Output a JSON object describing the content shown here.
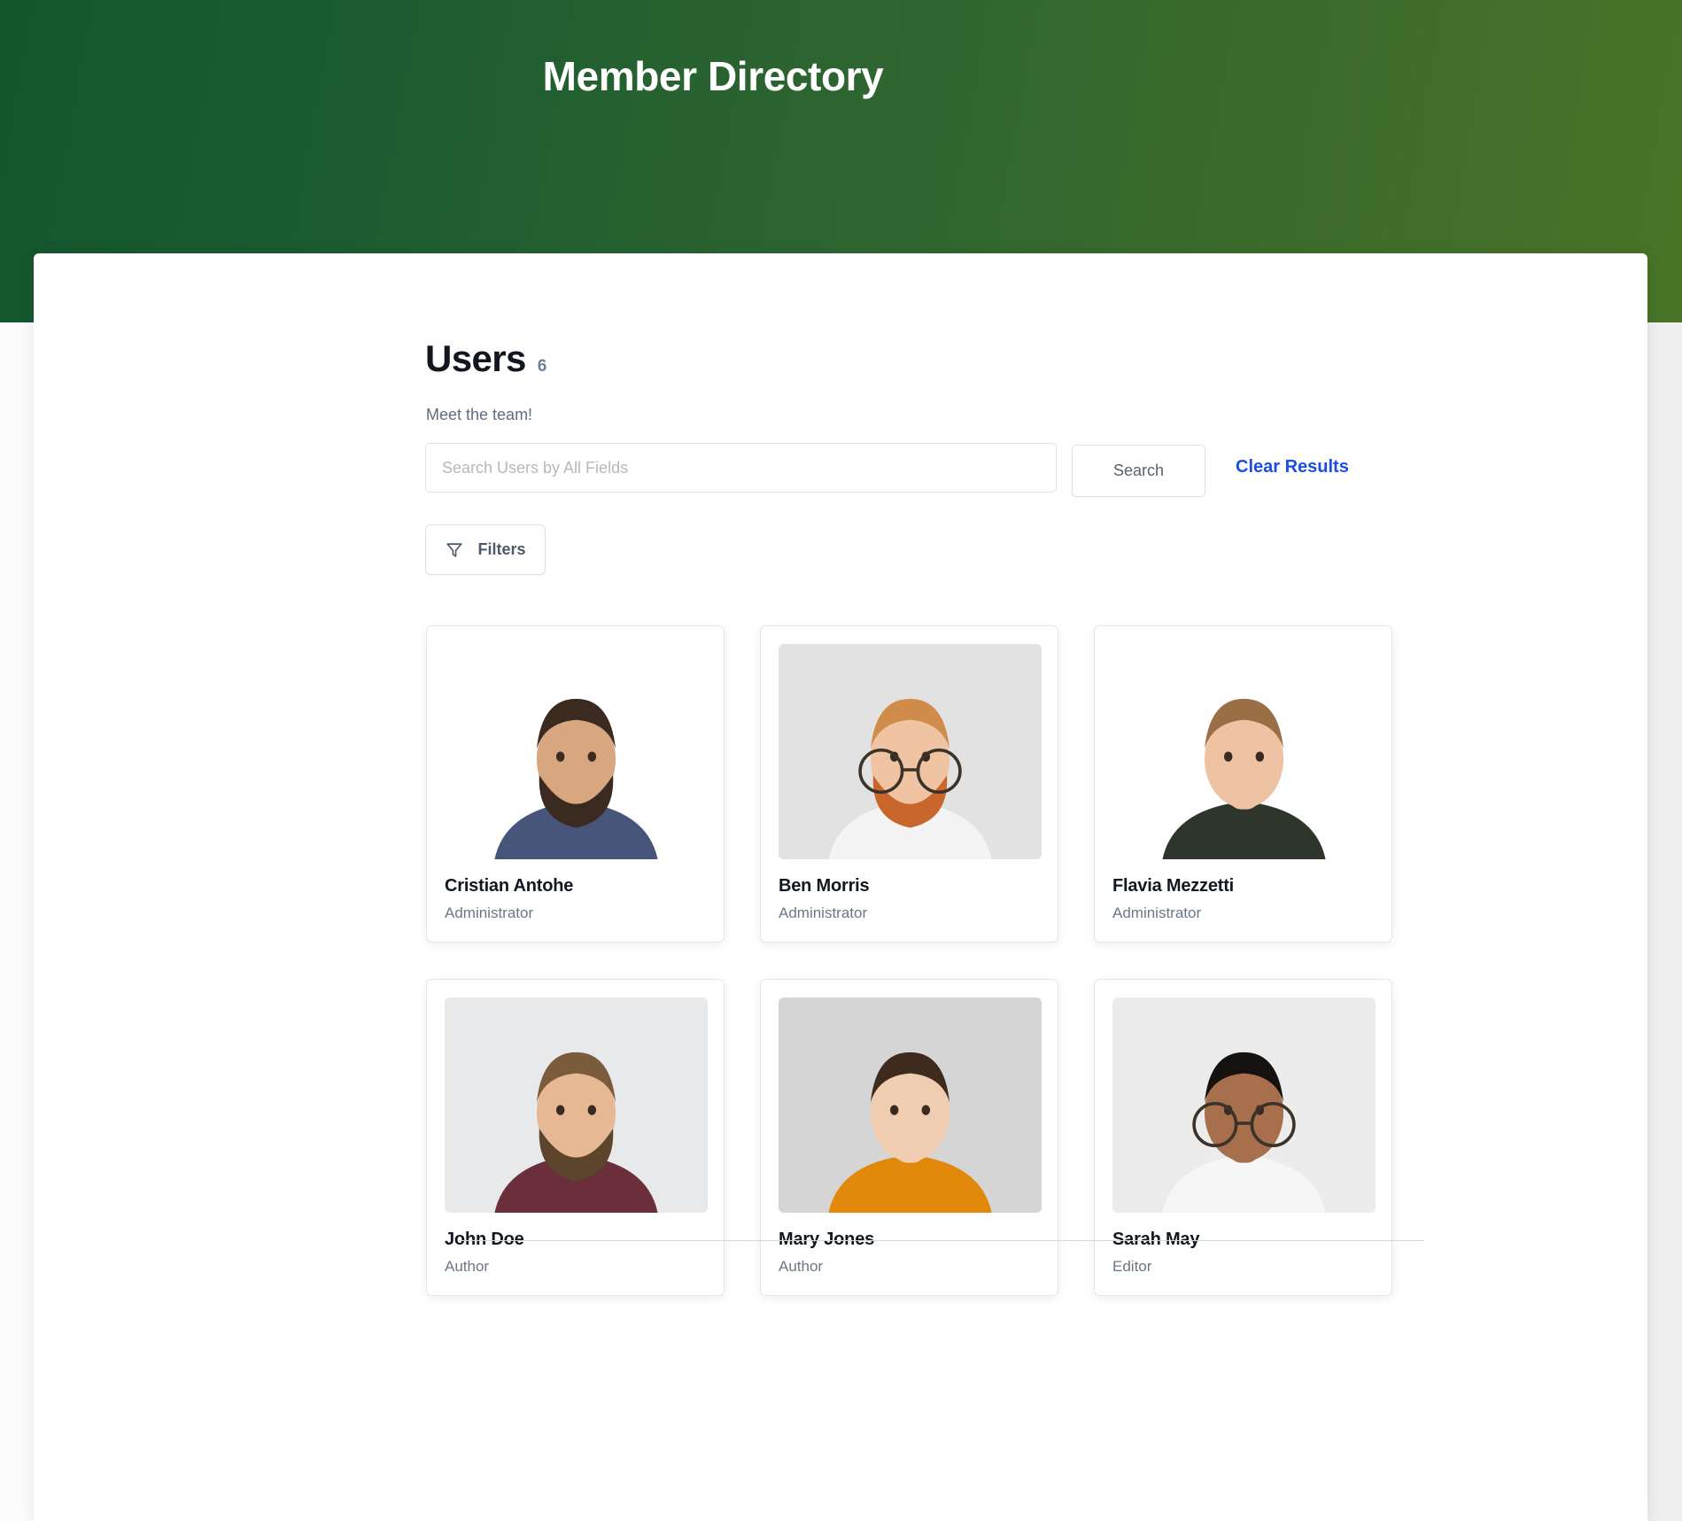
{
  "header": {
    "title": "Member Directory",
    "gradient_from": "#14562f",
    "gradient_to": "#497428"
  },
  "main": {
    "heading": "Users",
    "count": "6",
    "subtitle": "Meet the team!"
  },
  "search": {
    "placeholder": "Search Users by All Fields",
    "value": "",
    "search_button": "Search",
    "clear_link": "Clear Results",
    "clear_link_color": "#1b4ee5"
  },
  "filters": {
    "label": "Filters",
    "icon": "funnel-icon"
  },
  "users": [
    {
      "name": "Cristian Antohe",
      "role": "Administrator",
      "photo": {
        "background": "#ffffff",
        "skin": "#d8a780",
        "hair": "#3a2a20",
        "shirt": "#48557b",
        "beard": "#3a2a20",
        "glasses": false
      }
    },
    {
      "name": "Ben Morris",
      "role": "Administrator",
      "photo": {
        "background": "#e2e2e2",
        "skin": "#f0c4a2",
        "hair": "#d08c4a",
        "shirt": "#f4f4f4",
        "beard": "#c9662c",
        "glasses": true
      }
    },
    {
      "name": "Flavia Mezzetti",
      "role": "Administrator",
      "photo": {
        "background": "#ffffff",
        "skin": "#edc3a4",
        "hair": "#9a6f45",
        "shirt": "#2e352b",
        "beard": "",
        "glasses": false
      }
    },
    {
      "name": "John Doe",
      "role": "Author",
      "photo": {
        "background": "#e8e9ea",
        "skin": "#e6b894",
        "hair": "#7a5c3c",
        "shirt": "#6b2f3c",
        "beard": "#5d452d",
        "glasses": false
      }
    },
    {
      "name": "Mary Jones",
      "role": "Author",
      "photo": {
        "background": "#d5d5d5",
        "skin": "#f0cdb0",
        "hair": "#3f2a1e",
        "shirt": "#e2890b",
        "beard": "",
        "glasses": false
      }
    },
    {
      "name": "Sarah May",
      "role": "Editor",
      "photo": {
        "background": "#ececec",
        "skin": "#a86f4d",
        "hair": "#16120f",
        "shirt": "#f6f6f6",
        "beard": "",
        "glasses": true
      }
    }
  ]
}
